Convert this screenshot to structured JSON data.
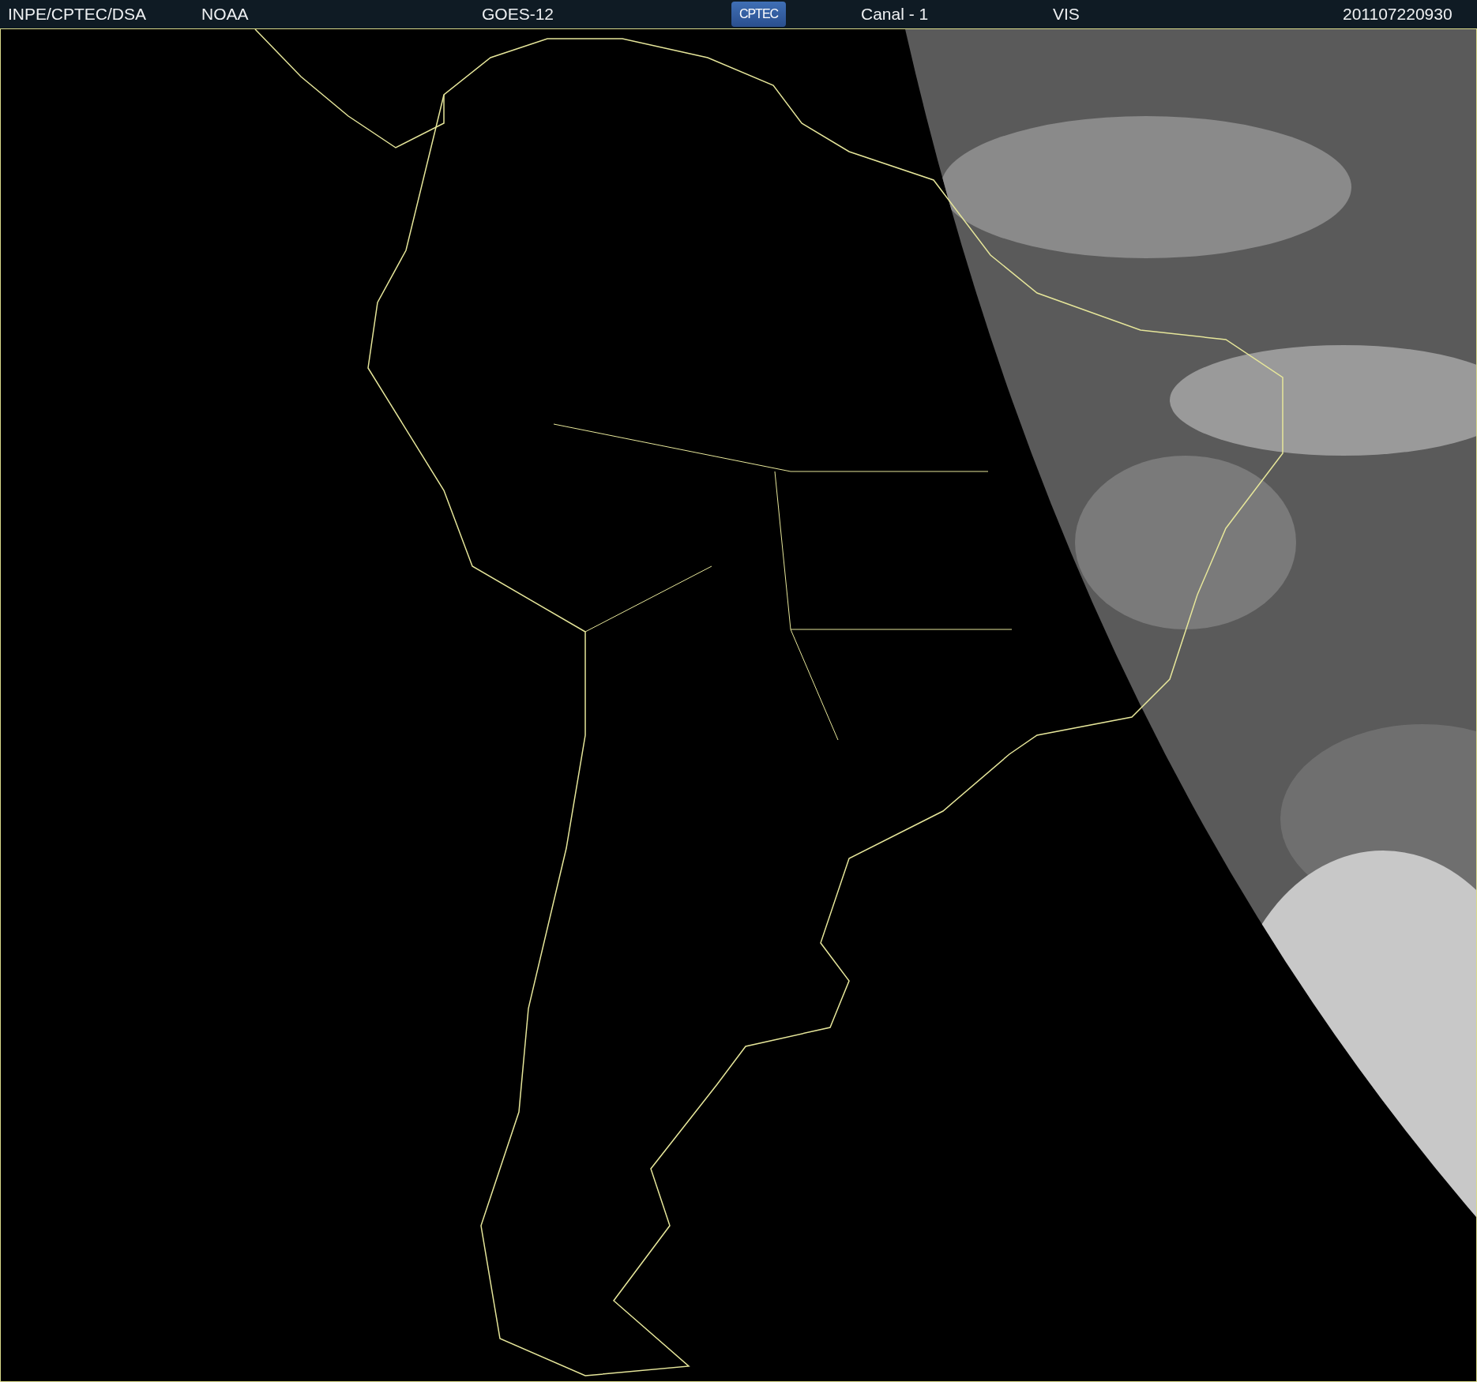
{
  "header": {
    "source": "INPE/CPTEC/DSA",
    "agency": "NOAA",
    "satellite": "GOES-12",
    "logo": "CPTEC",
    "channel": "Canal - 1",
    "band": "VIS",
    "timestamp": "201107220930"
  }
}
